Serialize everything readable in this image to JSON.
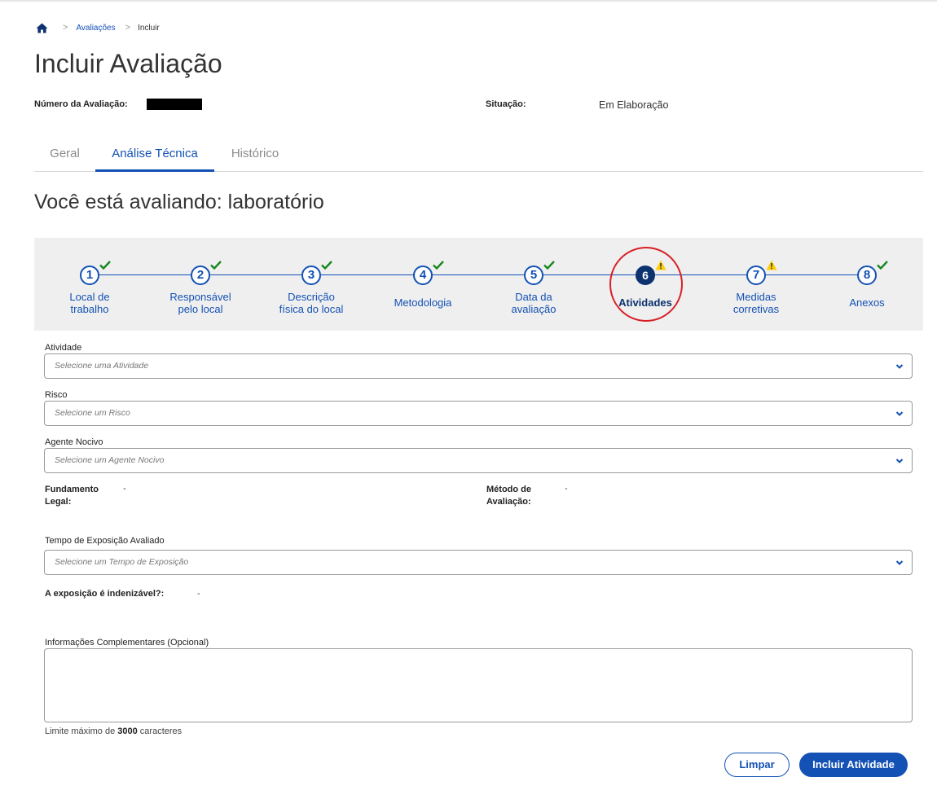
{
  "breadcrumb": {
    "home_icon": "home-icon",
    "items": [
      "Avaliações",
      "Incluir"
    ]
  },
  "page": {
    "title": "Incluir Avaliação"
  },
  "meta": {
    "numero_label": "Número da Avaliação:",
    "situacao_label": "Situação:",
    "situacao_value": "Em Elaboração"
  },
  "tabs": [
    {
      "label": "Geral",
      "active": false
    },
    {
      "label": "Análise Técnica",
      "active": true
    },
    {
      "label": "Histórico",
      "active": false
    }
  ],
  "section_title": "Você está avaliando: laboratório",
  "stepper": {
    "current_step": 6,
    "steps": [
      {
        "number": "1",
        "line1": "Local de",
        "line2": "trabalho",
        "status": "done"
      },
      {
        "number": "2",
        "line1": "Responsável",
        "line2": "pelo local",
        "status": "done"
      },
      {
        "number": "3",
        "line1": "Descrição",
        "line2": "física do local",
        "status": "done"
      },
      {
        "number": "4",
        "line1": "Metodologia",
        "line2": "",
        "status": "done"
      },
      {
        "number": "5",
        "line1": "Data da",
        "line2": "avaliação",
        "status": "done"
      },
      {
        "number": "6",
        "line1": "Atividades",
        "line2": "",
        "status": "warning"
      },
      {
        "number": "7",
        "line1": "Medidas",
        "line2": "corretivas",
        "status": "warning"
      },
      {
        "number": "8",
        "line1": "Anexos",
        "line2": "",
        "status": "done"
      }
    ],
    "colors": {
      "primary": "#1351b4",
      "current": "#0c326f",
      "done": "#168821",
      "warning": "#ffcd07",
      "highlight": "#d91f26"
    }
  },
  "form": {
    "atividade": {
      "label": "Atividade",
      "placeholder": "Selecione uma Atividade"
    },
    "risco": {
      "label": "Risco",
      "placeholder": "Selecione um Risco"
    },
    "agente": {
      "label": "Agente Nocivo",
      "placeholder": "Selecione um Agente Nocivo"
    },
    "fundamento": {
      "label_line1": "Fundamento",
      "label_line2": "Legal:",
      "value": "-"
    },
    "metodo": {
      "label_line1": "Método de",
      "label_line2": "Avaliação:",
      "value": "-"
    },
    "tempo": {
      "label": "Tempo de Exposição Avaliado",
      "placeholder": "Selecione um Tempo de Exposição"
    },
    "indenizavel": {
      "label": "A exposição é indenizável?:",
      "value": "-"
    },
    "info": {
      "label": "Informações Complementares (Opcional)",
      "value": ""
    },
    "limit": {
      "prefix": "Limite máximo de ",
      "count": "3000",
      "suffix": " caracteres"
    }
  },
  "actions": {
    "clear_label": "Limpar",
    "submit_label": "Incluir Atividade"
  }
}
